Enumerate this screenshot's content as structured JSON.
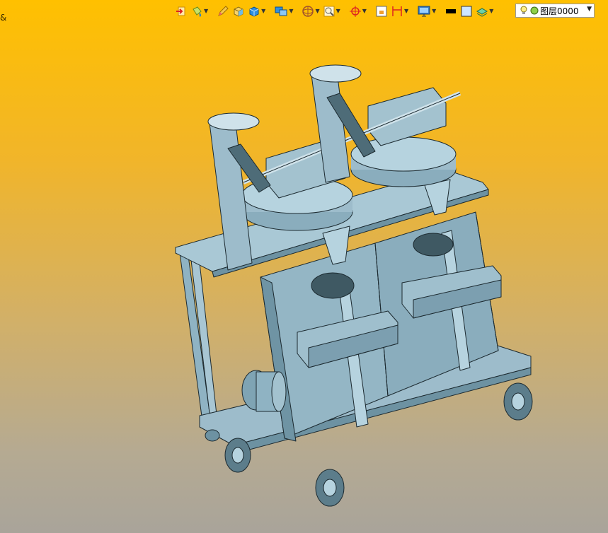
{
  "toolbar": {
    "icons": [
      {
        "name": "exit-icon",
        "dropdown": false
      },
      {
        "name": "paint-bucket-icon",
        "dropdown": true
      },
      {
        "name": "pencil-icon",
        "dropdown": false
      },
      {
        "name": "box-shaded-icon",
        "dropdown": false
      },
      {
        "name": "box-blue-icon",
        "dropdown": true
      },
      {
        "name": "views-icon",
        "dropdown": true
      },
      {
        "name": "sphere-icon",
        "dropdown": true
      },
      {
        "name": "zoom-window-icon",
        "dropdown": true
      },
      {
        "name": "crosshair-icon",
        "dropdown": true
      },
      {
        "name": "fit-icon",
        "dropdown": false
      },
      {
        "name": "dimension-icon",
        "dropdown": true
      },
      {
        "name": "monitor-icon",
        "dropdown": true
      }
    ],
    "color_swatch": "#000000",
    "fill_swatch": "#cde6ff"
  },
  "layer": {
    "label": "图层0000",
    "bulb_color": "#ffee88",
    "circle_color": "#8fd04a"
  },
  "stray_text": "&",
  "colors": {
    "model": "#8fb3c3",
    "model_dark": "#5f8494",
    "model_light": "#b6d3df",
    "edge": "#1c2a30"
  }
}
